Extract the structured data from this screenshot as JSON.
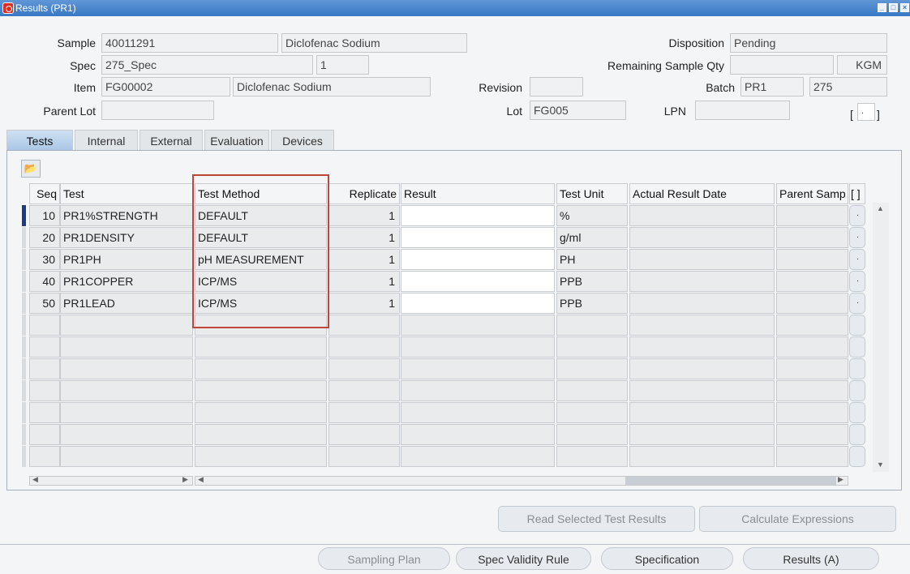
{
  "window": {
    "title": "Results (PR1)"
  },
  "header": {
    "sample_label": "Sample",
    "sample_value": "40011291",
    "sample_desc": "Diclofenac Sodium",
    "spec_label": "Spec",
    "spec_value": "275_Spec",
    "spec_version": "1",
    "item_label": "Item",
    "item_value": "FG00002",
    "item_desc": "Diclofenac Sodium",
    "parent_lot_label": "Parent Lot",
    "parent_lot_value": "",
    "revision_label": "Revision",
    "revision_value": "",
    "lot_label": "Lot",
    "lot_value": "FG005",
    "disposition_label": "Disposition",
    "disposition_value": "Pending",
    "remaining_qty_label": "Remaining Sample Qty",
    "remaining_qty_value": "",
    "remaining_qty_uom": "KGM",
    "batch_label": "Batch",
    "batch_value": "PR1",
    "batch_value2": "275",
    "lpn_label": "LPN",
    "lpn_value": "",
    "bracket_left": "[",
    "bracket_mid": ".",
    "bracket_right": "]"
  },
  "tabs": [
    "Tests",
    "Internal",
    "External",
    "Evaluation",
    "Devices"
  ],
  "table": {
    "columns": [
      "Seq",
      "Test",
      "Test Method",
      "Replicate",
      "Result",
      "Test Unit",
      "Actual Result Date",
      "Parent Samp",
      "[ ]"
    ],
    "rows": [
      {
        "seq": "10",
        "test": "PR1%STRENGTH",
        "method": "DEFAULT",
        "replicate": "1",
        "result": "",
        "unit": "%"
      },
      {
        "seq": "20",
        "test": "PR1DENSITY",
        "method": "DEFAULT",
        "replicate": "1",
        "result": "",
        "unit": "g/ml"
      },
      {
        "seq": "30",
        "test": "PR1PH",
        "method": "pH MEASUREMENT",
        "replicate": "1",
        "result": "",
        "unit": "PH"
      },
      {
        "seq": "40",
        "test": "PR1COPPER",
        "method": "ICP/MS",
        "replicate": "1",
        "result": "",
        "unit": "PPB"
      },
      {
        "seq": "50",
        "test": "PR1LEAD",
        "method": "ICP/MS",
        "replicate": "1",
        "result": "",
        "unit": "PPB"
      }
    ],
    "cell_button": "."
  },
  "actions": {
    "read_selected": "Read Selected Test Results",
    "calculate": "Calculate Expressions",
    "sampling_plan": "Sampling Plan",
    "spec_validity": "Spec Validity Rule",
    "specification": "Specification",
    "results": "Results (A)"
  },
  "colors": {
    "titlebar": "#3a78c4",
    "active_tab": "#a9c6e6",
    "highlight_box": "#c0463c",
    "current_row": "#1c3a8a"
  }
}
